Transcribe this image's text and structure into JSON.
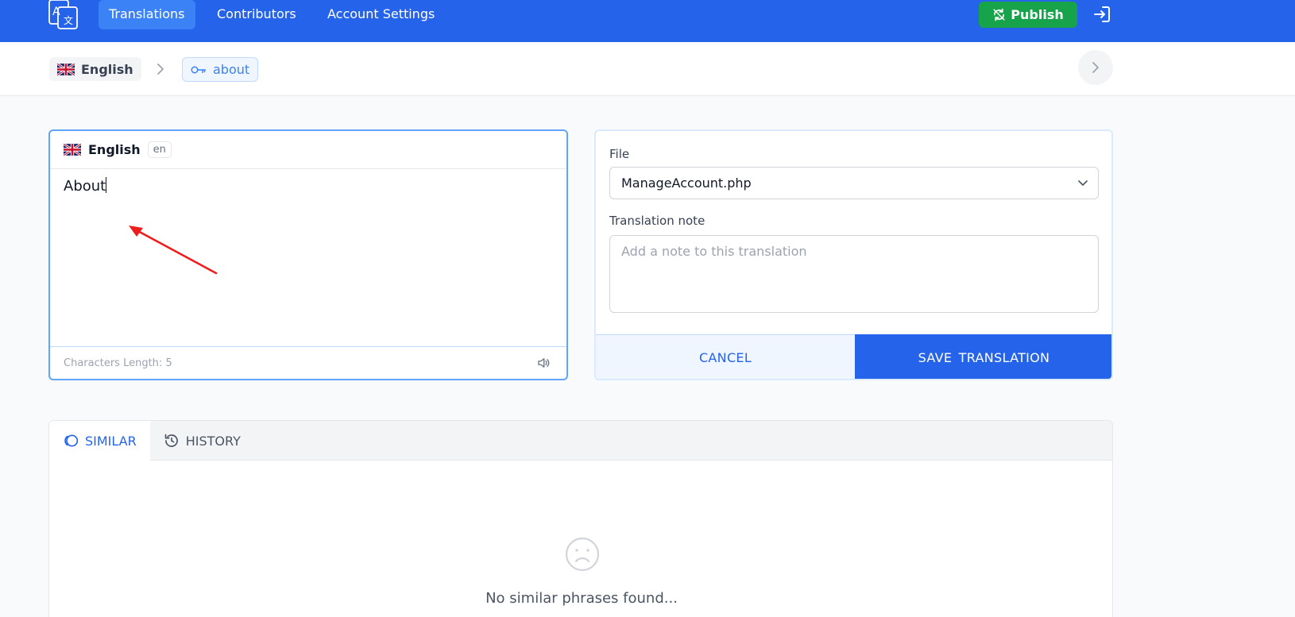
{
  "nav": {
    "items": [
      {
        "label": "Translations",
        "active": true
      },
      {
        "label": "Contributors",
        "active": false
      },
      {
        "label": "Account Settings",
        "active": false
      }
    ],
    "publish_label": "Publish"
  },
  "breadcrumb": {
    "language": "English",
    "key": "about"
  },
  "editor": {
    "language": "English",
    "code": "en",
    "text": "About",
    "footer": "Characters Length: 5"
  },
  "side": {
    "file_label": "File",
    "file_value": "ManageAccount.php",
    "note_label": "Translation note",
    "note_placeholder": "Add a note to this translation",
    "cancel_label": "CANCEL",
    "save_label": "SAVE TRANSLATION"
  },
  "tabs": {
    "similar": "SIMILAR",
    "history": "HISTORY",
    "empty_text": "No similar phrases found..."
  },
  "colors": {
    "primary": "#2563eb",
    "publish": "#16a34a",
    "annotation_arrow": "#ef1c1c"
  }
}
